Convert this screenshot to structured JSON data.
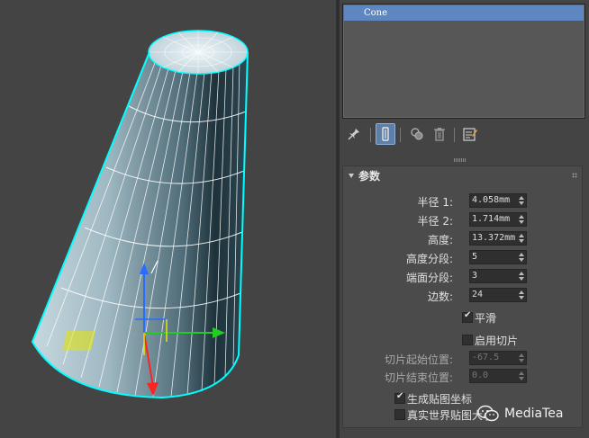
{
  "modifier_stack": {
    "items": [
      {
        "label": "Cone",
        "selected": true
      }
    ]
  },
  "toolbar": {
    "icons": [
      "pin-stack-icon",
      "show-end-result-icon",
      "make-unique-icon",
      "remove-modifier-icon",
      "configure-modifier-sets-icon"
    ],
    "active": "show-end-result-icon"
  },
  "parameters": {
    "title": "参数",
    "radius1": {
      "label": "半径 1:",
      "value": "4.058mm"
    },
    "radius2": {
      "label": "半径 2:",
      "value": "1.714mm"
    },
    "height": {
      "label": "高度:",
      "value": "13.372mm"
    },
    "height_segments": {
      "label": "高度分段:",
      "value": "5"
    },
    "cap_segments": {
      "label": "端面分段:",
      "value": "3"
    },
    "sides": {
      "label": "边数:",
      "value": "24"
    },
    "smooth": {
      "label": "平滑",
      "checked": true
    },
    "slice_on": {
      "label": "启用切片",
      "checked": false
    },
    "slice_from": {
      "label": "切片起始位置:",
      "value": "-67.5"
    },
    "slice_to": {
      "label": "切片结束位置:",
      "value": "0.0"
    },
    "gen_mapping": {
      "label": "生成贴图坐标",
      "checked": true
    },
    "real_world": {
      "label": "真实世界贴图大小",
      "checked": false
    }
  },
  "watermark": {
    "text": "MediaTea"
  },
  "colors": {
    "accent": "#5e87c2",
    "selection_wire": "#00ffff",
    "viewport_bg": "#444444"
  }
}
